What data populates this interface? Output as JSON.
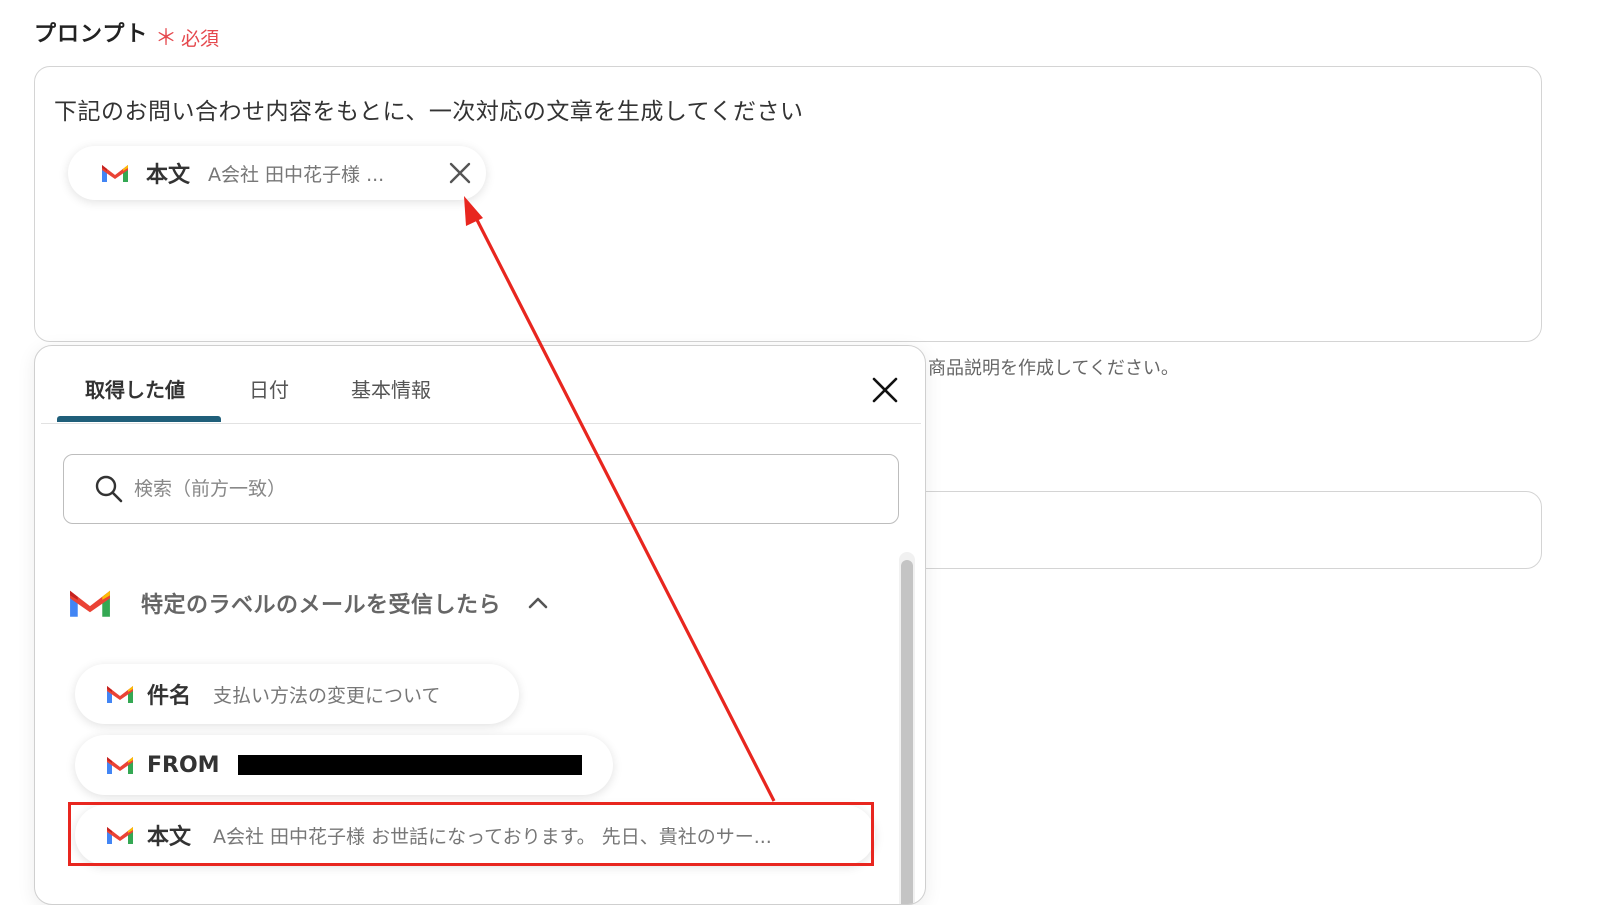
{
  "prompt_field": {
    "label": "プロンプト",
    "required_star": "＊",
    "required_text": "必須",
    "text": "下記のお問い合わせ内容をもとに、一次対応の文章を生成してください",
    "inserted_chip": {
      "key": "本文",
      "value": "A会社 田中花子様 ..."
    }
  },
  "hint_text": "商品説明を作成してください。",
  "popup": {
    "tabs": [
      {
        "label": "取得した値",
        "active": true
      },
      {
        "label": "日付",
        "active": false
      },
      {
        "label": "基本情報",
        "active": false
      }
    ],
    "search": {
      "placeholder": "検索（前方一致）",
      "value": ""
    },
    "section": {
      "title": "特定のラベルのメールを受信したら",
      "expanded": true
    },
    "items": [
      {
        "key": "件名",
        "value": "支払い方法の変更について"
      },
      {
        "key": "FROM",
        "value": "",
        "redacted": true
      },
      {
        "key": "本文",
        "value": "A会社 田中花子様 お世話になっております。 先日、貴社のサー...",
        "highlighted": true
      }
    ]
  },
  "colors": {
    "required": "#e5484d",
    "tab_underline": "#1f5f7a",
    "annotation_red": "#e8261f"
  },
  "icons": [
    "gmail-icon",
    "close-icon",
    "search-icon",
    "chevron-up-icon"
  ]
}
